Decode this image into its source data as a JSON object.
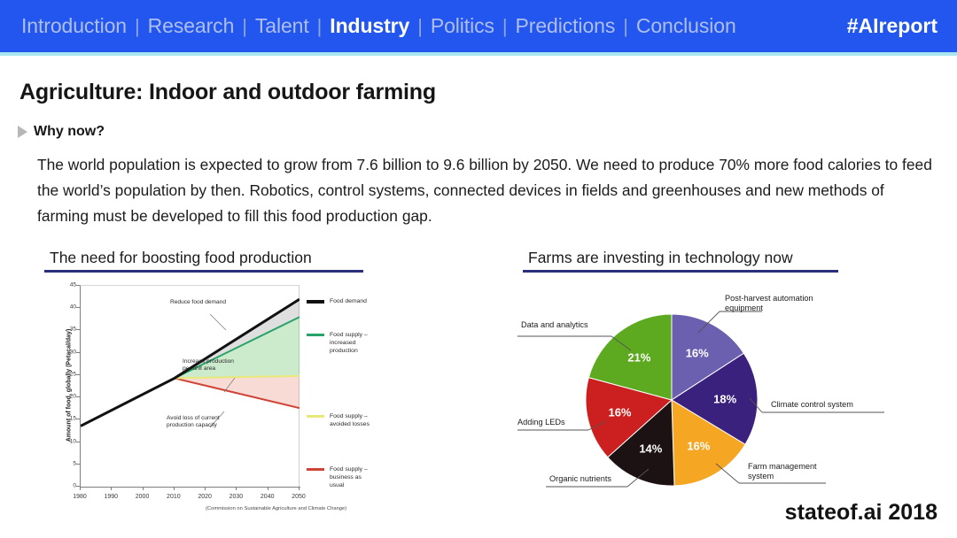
{
  "nav": {
    "items": [
      {
        "label": "Introduction",
        "active": false
      },
      {
        "label": "Research",
        "active": false
      },
      {
        "label": "Talent",
        "active": false
      },
      {
        "label": "Industry",
        "active": true
      },
      {
        "label": "Politics",
        "active": false
      },
      {
        "label": "Predictions",
        "active": false
      },
      {
        "label": "Conclusion",
        "active": false
      }
    ],
    "separator": "|",
    "hashtag": "#AIreport",
    "bar_color": "#2256ee",
    "underline_color": "#a8e6ef"
  },
  "slide": {
    "title": "Agriculture: Indoor and outdoor farming",
    "bullet_label": "Why now?",
    "body": "The world population is expected to grow from 7.6 billion to 9.6 billion by 2050. We need to produce 70% more food calories to feed the world’s population by then. Robotics, control systems, connected devices in fields and greenhouses and new methods of farming must be developed to fill this food production gap.",
    "left_section_title": "The need for boosting food production",
    "right_section_title": "Farms are investing in technology now",
    "footer_brand": "stateof.ai 2018",
    "rule_color": "#2b2f7a"
  },
  "chart_data": [
    {
      "type": "line",
      "title": "The need for boosting food production",
      "xlabel": "",
      "ylabel": "Amount of food, globally (Petacal/day)",
      "source": "(Commission on Sustainable Agriculture and Climate Change)",
      "xlim": [
        1980,
        2050
      ],
      "ylim": [
        0,
        45
      ],
      "xticks": [
        1980,
        1990,
        2000,
        2010,
        2020,
        2030,
        2040,
        2050
      ],
      "yticks": [
        0,
        5,
        10,
        15,
        20,
        25,
        30,
        35,
        40,
        45
      ],
      "grid": false,
      "legend_position": "right",
      "annotations": [
        {
          "text": "Reduce food demand"
        },
        {
          "text": "Increase production per unit area"
        },
        {
          "text": "Avoid loss of current production capacity"
        }
      ],
      "series": [
        {
          "name": "Food demand",
          "color": "#111111",
          "x": [
            1980,
            2010,
            2050
          ],
          "values": [
            13.6,
            24.3,
            42.0
          ]
        },
        {
          "name": "Food supply – increased production",
          "color": "#27a36a",
          "x": [
            1980,
            2010,
            2050
          ],
          "values": [
            13.6,
            24.3,
            38.0
          ]
        },
        {
          "name": "Food supply – avoided losses",
          "color": "#e9e87a",
          "x": [
            1980,
            2010,
            2050
          ],
          "values": [
            13.6,
            24.3,
            24.8
          ]
        },
        {
          "name": "Food supply – business as usual",
          "color": "#cf4436",
          "x": [
            1980,
            2010,
            2050
          ],
          "values": [
            13.6,
            24.3,
            17.6
          ]
        }
      ]
    },
    {
      "type": "pie",
      "title": "Farms are investing in technology now",
      "labels": [
        "Post-harvest automation equipment",
        "Climate control system",
        "Farm management system",
        "Organic nutrients",
        "Adding LEDs",
        "Data and analytics"
      ],
      "values": [
        16,
        18,
        16,
        14,
        16,
        21
      ],
      "value_labels": [
        "16%",
        "18%",
        "16%",
        "14%",
        "16%",
        "21%"
      ],
      "colors": [
        "#6b5faf",
        "#3b217e",
        "#f5a623",
        "#1c1214",
        "#cc1f1f",
        "#5daa20"
      ],
      "start_angle_deg": 0,
      "direction": "clockwise"
    }
  ]
}
